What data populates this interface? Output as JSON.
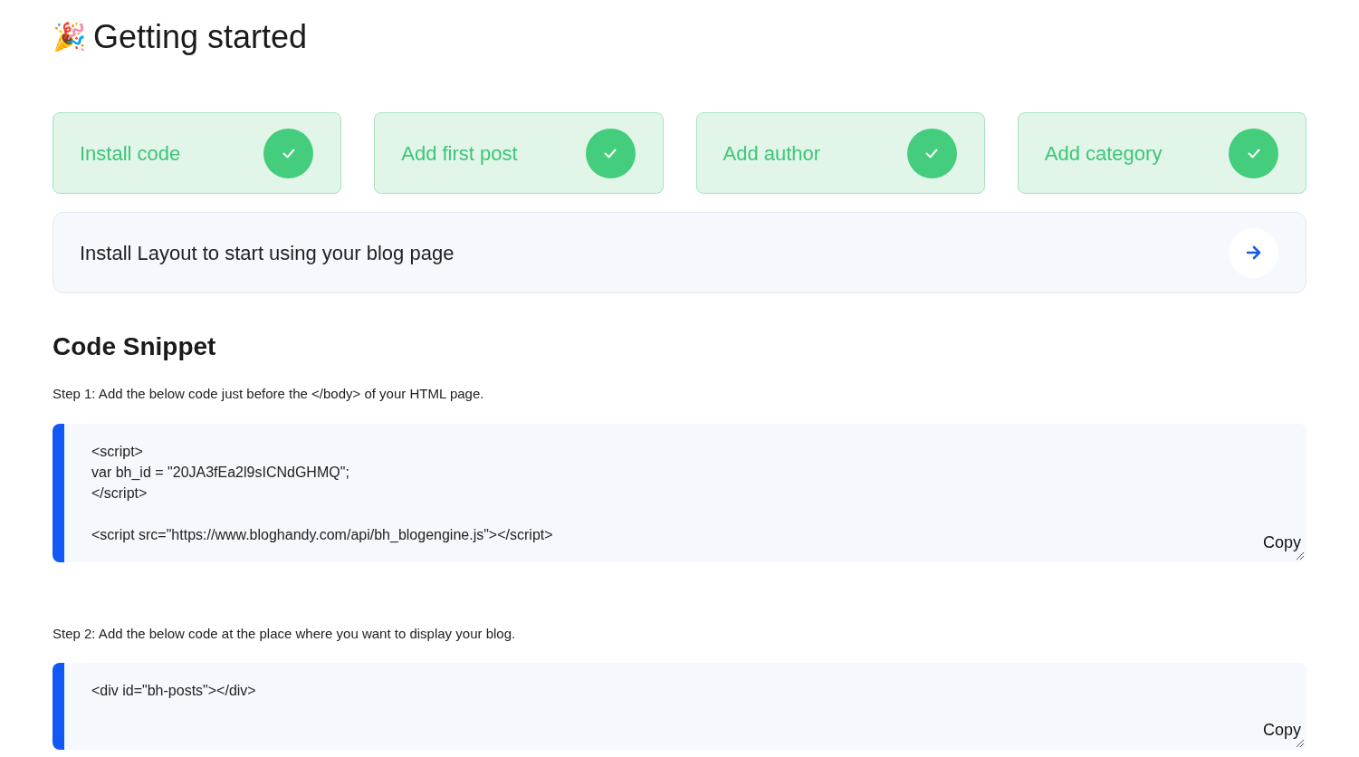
{
  "header": {
    "emoji": "🎉",
    "title": "Getting started"
  },
  "steps": [
    {
      "label": "Install code",
      "done": true
    },
    {
      "label": "Add first post",
      "done": true
    },
    {
      "label": "Add author",
      "done": true
    },
    {
      "label": "Add category",
      "done": true
    }
  ],
  "install_banner": {
    "text": "Install Layout to start using your blog page"
  },
  "code_snippet": {
    "title": "Code Snippet",
    "blocks": [
      {
        "instruction": "Step 1: Add the below code just before the </body> of your HTML page.",
        "code": "<script>\nvar bh_id = \"20JA3fEa2l9sICNdGHMQ\";\n</script>\n\n<script src=\"https://www.bloghandy.com/api/bh_blogengine.js\"></script>",
        "copy": "Copy"
      },
      {
        "instruction": "Step 2: Add the below code at the place where you want to display your blog.",
        "code": "<div id=\"bh-posts\"></div>",
        "copy": "Copy"
      }
    ]
  }
}
